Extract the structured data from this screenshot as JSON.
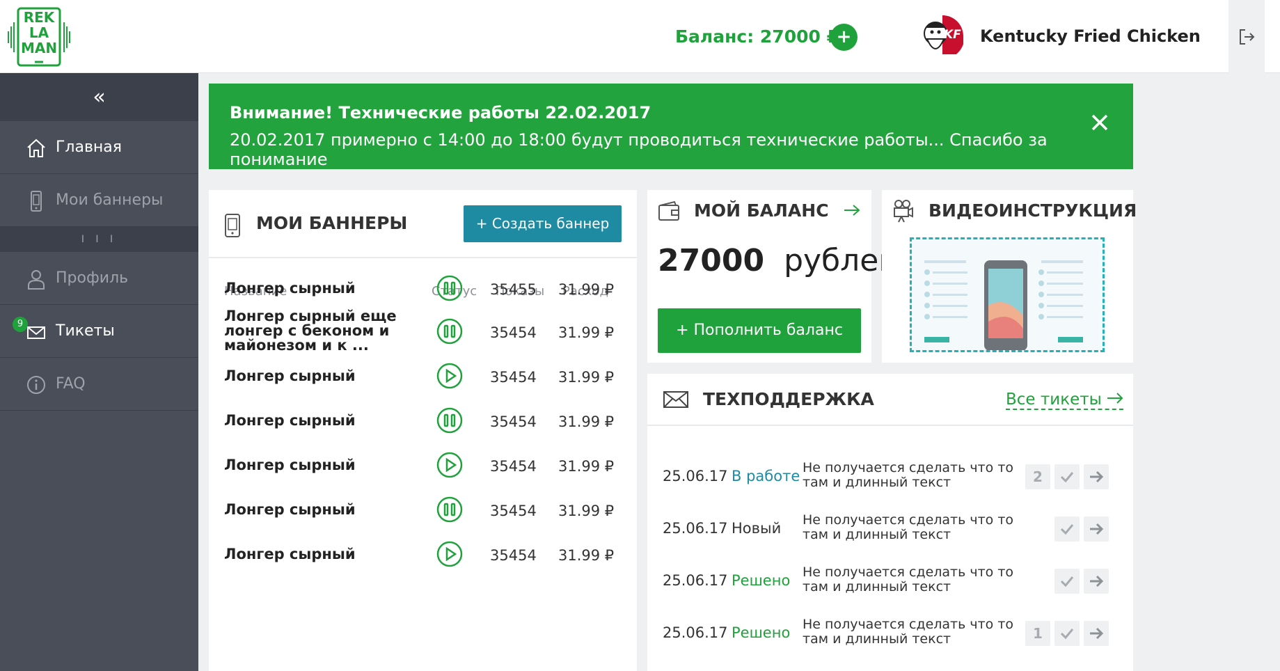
{
  "header": {
    "logo_lines": [
      "REK",
      "LA",
      "MAN"
    ],
    "balance_text": "Баланс: 27000 ₽",
    "add_label": "+",
    "company": "Kentucky Fried Chicken",
    "avatar_text": "KF"
  },
  "sidebar": {
    "collapse_label": "«",
    "handle_label": "I I I",
    "items": [
      {
        "label": "Главная"
      },
      {
        "label": "Мои баннеры"
      },
      {
        "label": "Профиль"
      },
      {
        "label": "Тикеты",
        "badge": "9"
      },
      {
        "label": "FAQ"
      }
    ]
  },
  "alert": {
    "title": "Внимание! Технические работы 22.02.2017",
    "text": "20.02.2017 примерно с 14:00 до 18:00 будут проводиться технические работы... Спасибо за понимание"
  },
  "banners": {
    "title": "МОИ БАННЕРЫ",
    "create_label": "+ Создать баннер",
    "columns": [
      "Название",
      "Статус",
      "Показы",
      "Расход"
    ],
    "rows": [
      {
        "name": "Лонгер сырный",
        "status": "pause",
        "shows": "35455",
        "spend": "31.99 ₽"
      },
      {
        "name": "Лонгер сырный еще лонгер с беконом и майонезом и к ...",
        "status": "pause",
        "shows": "35454",
        "spend": "31.99 ₽"
      },
      {
        "name": "Лонгер сырный",
        "status": "play",
        "shows": "35454",
        "spend": "31.99 ₽"
      },
      {
        "name": "Лонгер сырный",
        "status": "pause",
        "shows": "35454",
        "spend": "31.99 ₽"
      },
      {
        "name": "Лонгер сырный",
        "status": "play",
        "shows": "35454",
        "spend": "31.99 ₽"
      },
      {
        "name": "Лонгер сырный",
        "status": "pause",
        "shows": "35454",
        "spend": "31.99 ₽"
      },
      {
        "name": "Лонгер сырный",
        "status": "play",
        "shows": "35454",
        "spend": "31.99 ₽"
      }
    ]
  },
  "balance_card": {
    "title": "МОЙ БАЛАНС",
    "amount": "27000",
    "currency": "рублей",
    "topup_label": "+ Пополнить баланс"
  },
  "video_card": {
    "title": "ВИДЕОИНСТРУКЦИЯ"
  },
  "support": {
    "title": "ТЕХПОДДЕРЖКА",
    "all_label": "Все тикеты",
    "tickets": [
      {
        "date": "25.06.17",
        "status": "В работе",
        "status_color": "#1e8ba3",
        "text": "Не получается сделать что то там и длинный текст",
        "count": "2"
      },
      {
        "date": "25.06.17",
        "status": "Новый",
        "status_color": "#333333",
        "text": "Не получается сделать что то там и длинный текст",
        "count": ""
      },
      {
        "date": "25.06.17",
        "status": "Решено",
        "status_color": "#1fa23b",
        "text": "Не получается сделать что то там и длинный текст",
        "count": ""
      },
      {
        "date": "25.06.17",
        "status": "Решено",
        "status_color": "#1fa23b",
        "text": "Не получается сделать что то там и длинный текст",
        "count": "1"
      }
    ]
  },
  "colors": {
    "brand_green": "#1fa23b",
    "accent_teal": "#1e8ba3",
    "sidebar": "#4a4e58"
  }
}
